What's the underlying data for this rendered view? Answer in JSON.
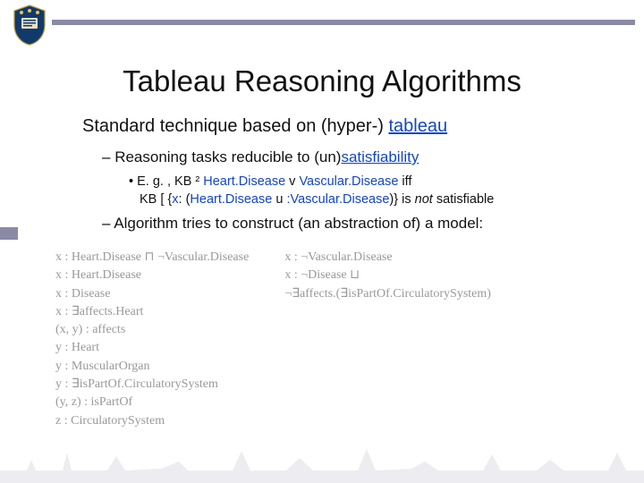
{
  "title": "Tableau Reasoning Algorithms",
  "lead": {
    "pre": "Standard technique based on (hyper-) ",
    "key": "tableau"
  },
  "bullet1": {
    "pre": "Reasoning tasks reducible to (un)",
    "key": "satisfiability"
  },
  "example": {
    "a1": "E. g. , KB ",
    "sym1": "²",
    "a2": " Heart.Disease ",
    "sym2": "v",
    "a3": " Vascular.Disease",
    "a4": " iff",
    "b1": "KB ",
    "sym3": "[",
    "b2": " {",
    "x": "x",
    "b3": ": (",
    "c1": "Heart.Disease ",
    "sym4": "u",
    "c2": " ",
    "neg": ":",
    "c3": "Vascular.Disease",
    "b4": ")} is ",
    "not": "not",
    "b5": " satisfiable"
  },
  "bullet2": "Algorithm tries to construct (an abstraction of) a model:",
  "math": {
    "left": [
      "x : Heart.Disease ⊓ ¬Vascular.Disease",
      "x : Heart.Disease",
      "x : Disease",
      "x : ∃affects.Heart",
      "(x, y) : affects",
      "y : Heart",
      "y : MuscularOrgan",
      "y : ∃isPartOf.CirculatorySystem",
      "(y, z) : isPartOf",
      "z : CirculatorySystem"
    ],
    "right": [
      "x : ¬Vascular.Disease",
      "x : ¬Disease ⊔",
      "    ¬∃affects.(∃isPartOf.CirculatorySystem)"
    ]
  }
}
